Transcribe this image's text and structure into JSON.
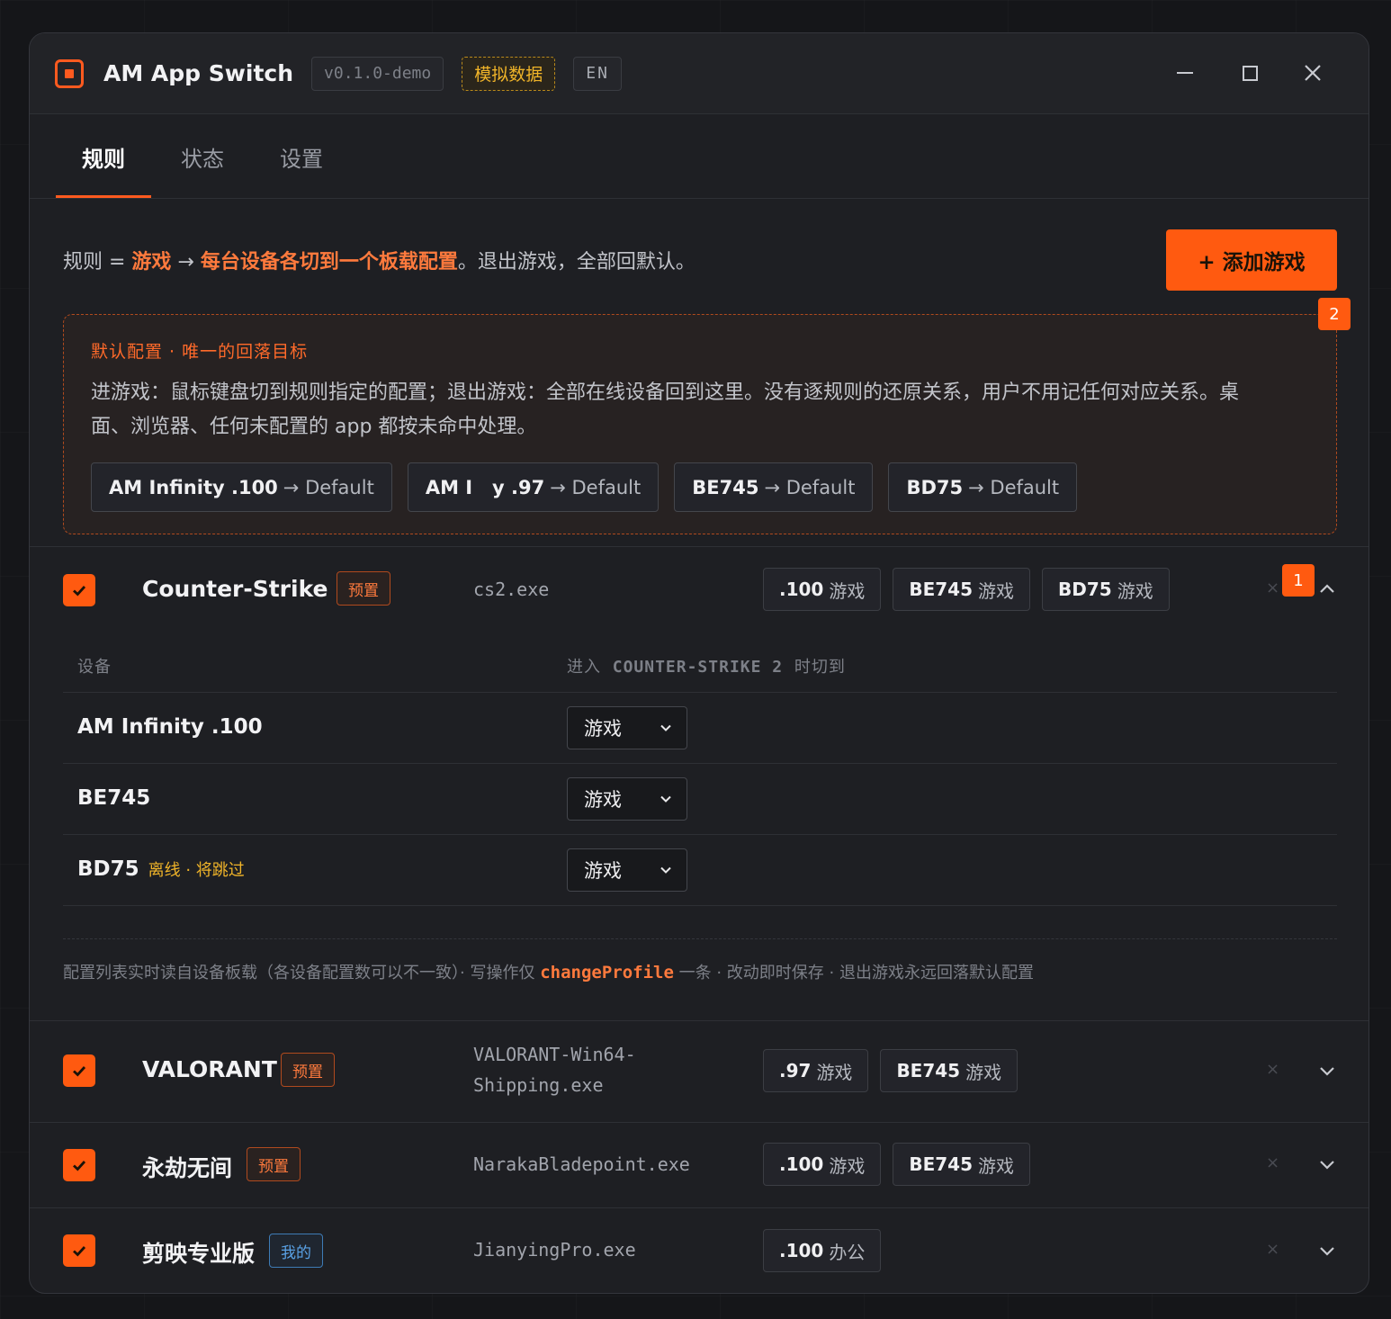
{
  "titlebar": {
    "title": "AM App Switch",
    "version": "v0.1.0-demo",
    "demo_badge": "模拟数据",
    "lang": "EN"
  },
  "tabs": [
    {
      "label": "规则",
      "active": true
    },
    {
      "label": "状态",
      "active": false
    },
    {
      "label": "设置",
      "active": false
    }
  ],
  "intro": {
    "prefix": "规则 = ",
    "game": "游戏",
    "arrow": " → ",
    "target": "每台设备各切到一个板载配置",
    "suffix": "。退出游戏，全部回默认。"
  },
  "add_button": "+ 添加游戏",
  "badges": {
    "default_box": "2",
    "first_row": "1"
  },
  "default_config": {
    "heading": "默认配置 · 唯一的回落目标",
    "description": "进游戏：鼠标键盘切到规则指定的配置；退出游戏：全部在线设备回到这里。没有逐规则的还原关系，用户不用记任何对应关系。桌面、浏览器、任何未配置的 app 都按未命中处理。",
    "chips": [
      {
        "device": "AM Infinity .100",
        "target": "→ Default"
      },
      {
        "device": "AM I   y .97",
        "target": "→ Default"
      },
      {
        "device": "BE745",
        "target": "→ Default"
      },
      {
        "device": "BD75",
        "target": "→ Default"
      }
    ]
  },
  "games": [
    {
      "name": "Counter-Strike 2",
      "tag": "预置",
      "exe": "cs2.exe",
      "profiles": [
        {
          "device": ".100",
          "profile": "游戏"
        },
        {
          "device": "BE745",
          "profile": "游戏"
        },
        {
          "device": "BD75",
          "profile": "游戏"
        }
      ],
      "remove": "×",
      "expanded": true
    },
    {
      "name": "VALORANT",
      "tag": "预置",
      "exe": "VALORANT-Win64-Shipping.exe",
      "exe_line1": "VALORANT-Win64-",
      "exe_line2": "Shipping.exe",
      "profiles": [
        {
          "device": ".97",
          "profile": "游戏"
        },
        {
          "device": "BE745",
          "profile": "游戏"
        }
      ],
      "remove": "×",
      "expanded": false
    },
    {
      "name": "永劫无间",
      "tag": "预置",
      "exe": "NarakaBladepoint.exe",
      "profiles": [
        {
          "device": ".100",
          "profile": "游戏"
        },
        {
          "device": "BE745",
          "profile": "游戏"
        }
      ],
      "remove": "×",
      "expanded": false
    },
    {
      "name": "剪映专业版",
      "tag": "我的",
      "exe": "JianyingPro.exe",
      "profiles": [
        {
          "device": ".100",
          "profile": "办公"
        }
      ],
      "remove": "×",
      "expanded": false
    }
  ],
  "detail": {
    "col_device": "设备",
    "col_target_prefix": "进入",
    "col_target_game": "COUNTER-STRIKE 2",
    "col_target_suffix": "时切到",
    "rows": [
      {
        "device": "AM Infinity .100",
        "status": "",
        "selected": "游戏"
      },
      {
        "device": "BE745",
        "status": "",
        "selected": "游戏"
      },
      {
        "device": "BD75",
        "status": "离线 · 将跳过",
        "selected": "游戏"
      }
    ],
    "footnote_a": "配置列表实时读自设备板载（各设备配置数可以不一致）· 写操作仅",
    "footnote_code": "changeProfile",
    "footnote_b": "一条 · 改动即时保存 · 退出游戏永远回落默认配置"
  },
  "colors": {
    "accent": "#ff5a10",
    "warning": "#f0b429",
    "mine": "#5aa2e6"
  }
}
